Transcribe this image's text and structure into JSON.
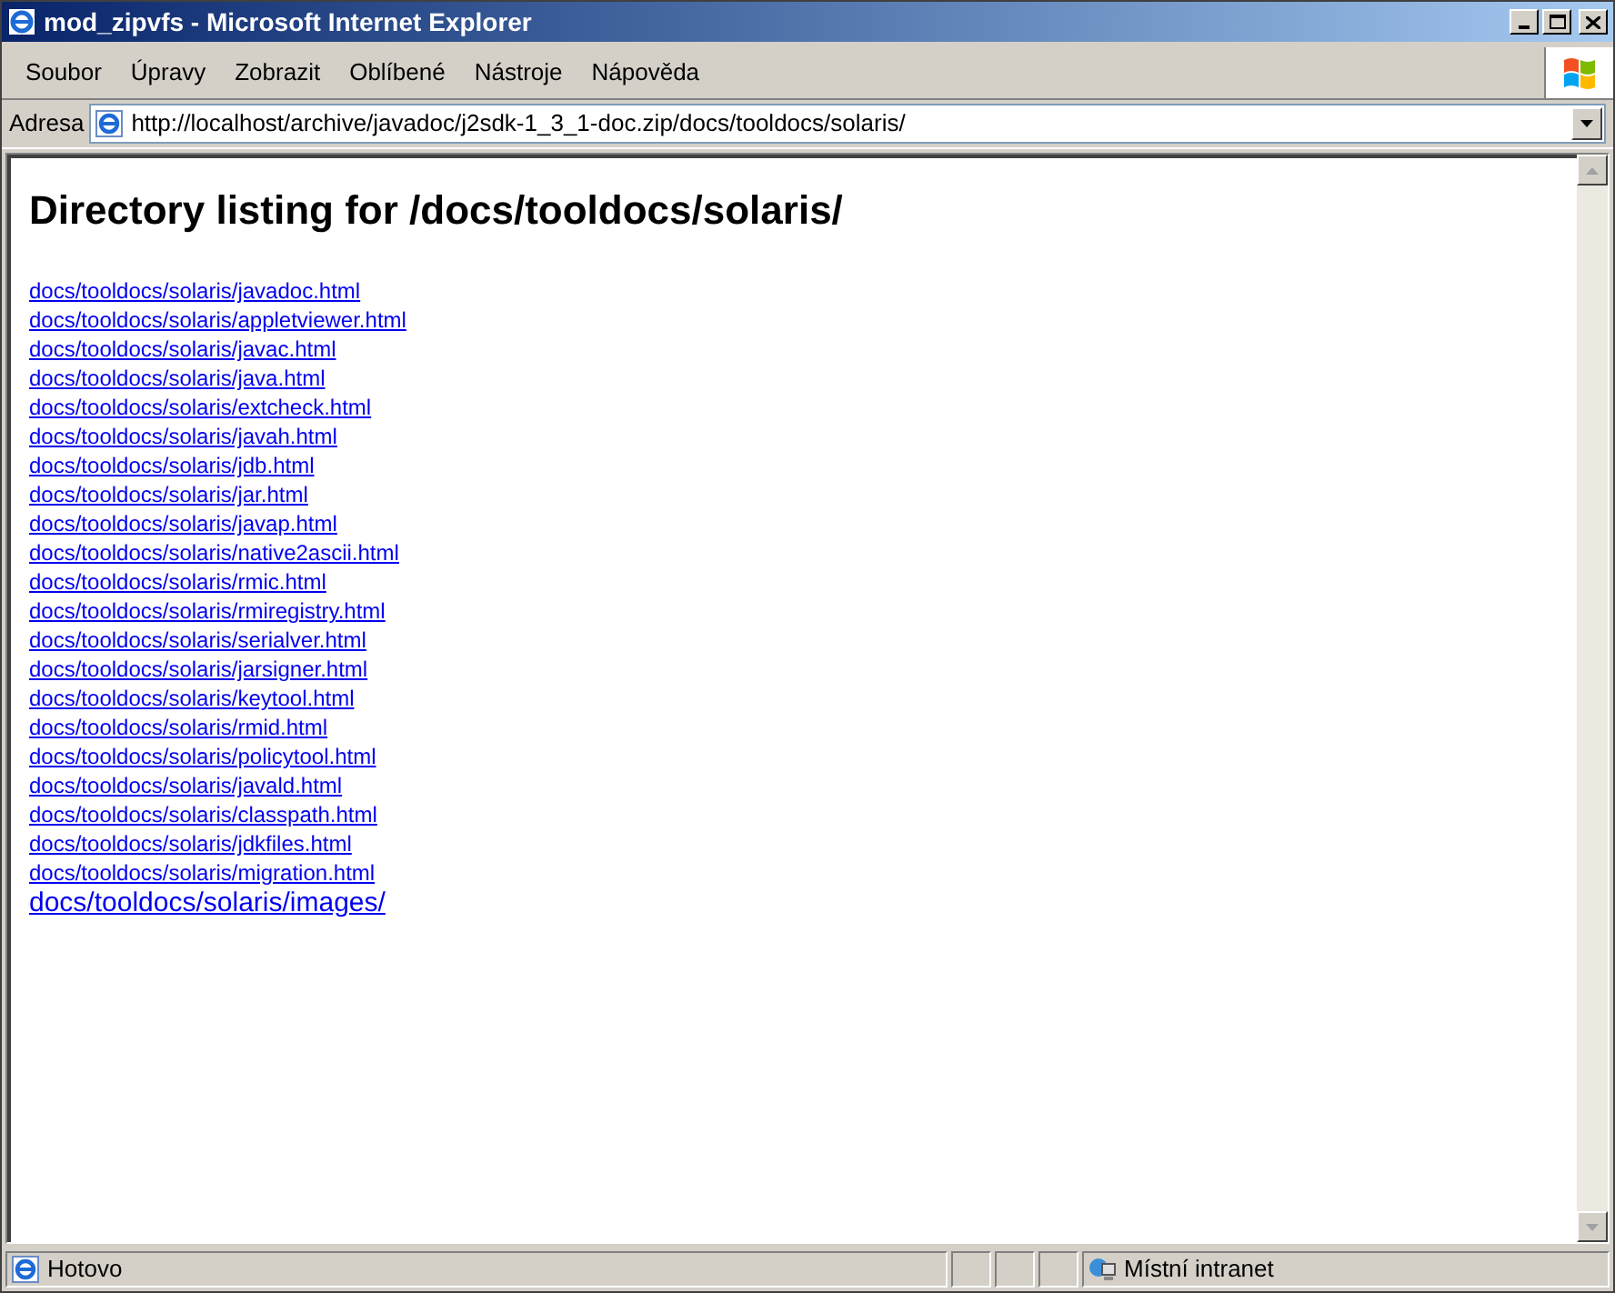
{
  "window": {
    "title": "mod_zipvfs - Microsoft Internet Explorer"
  },
  "menu": [
    "Soubor",
    "Úpravy",
    "Zobrazit",
    "Oblíbené",
    "Nástroje",
    "Nápověda"
  ],
  "address_bar": {
    "label": "Adresa",
    "value": "http://localhost/archive/javadoc/j2sdk-1_3_1-doc.zip/docs/tooldocs/solaris/"
  },
  "page": {
    "heading": "Directory listing for /docs/tooldocs/solaris/",
    "links": [
      {
        "text": "docs/tooldocs/solaris/javadoc.html",
        "kind": "file"
      },
      {
        "text": "docs/tooldocs/solaris/appletviewer.html",
        "kind": "file"
      },
      {
        "text": "docs/tooldocs/solaris/javac.html",
        "kind": "file"
      },
      {
        "text": "docs/tooldocs/solaris/java.html",
        "kind": "file"
      },
      {
        "text": "docs/tooldocs/solaris/extcheck.html",
        "kind": "file"
      },
      {
        "text": "docs/tooldocs/solaris/javah.html",
        "kind": "file"
      },
      {
        "text": "docs/tooldocs/solaris/jdb.html",
        "kind": "file"
      },
      {
        "text": "docs/tooldocs/solaris/jar.html",
        "kind": "file"
      },
      {
        "text": "docs/tooldocs/solaris/javap.html",
        "kind": "file"
      },
      {
        "text": "docs/tooldocs/solaris/native2ascii.html",
        "kind": "file"
      },
      {
        "text": "docs/tooldocs/solaris/rmic.html",
        "kind": "file"
      },
      {
        "text": "docs/tooldocs/solaris/rmiregistry.html",
        "kind": "file"
      },
      {
        "text": "docs/tooldocs/solaris/serialver.html",
        "kind": "file"
      },
      {
        "text": "docs/tooldocs/solaris/jarsigner.html",
        "kind": "file"
      },
      {
        "text": "docs/tooldocs/solaris/keytool.html",
        "kind": "file"
      },
      {
        "text": "docs/tooldocs/solaris/rmid.html",
        "kind": "file"
      },
      {
        "text": "docs/tooldocs/solaris/policytool.html",
        "kind": "file"
      },
      {
        "text": "docs/tooldocs/solaris/javald.html",
        "kind": "file"
      },
      {
        "text": "docs/tooldocs/solaris/classpath.html",
        "kind": "file"
      },
      {
        "text": "docs/tooldocs/solaris/jdkfiles.html",
        "kind": "file"
      },
      {
        "text": "docs/tooldocs/solaris/migration.html",
        "kind": "file"
      },
      {
        "text": "docs/tooldocs/solaris/images/",
        "kind": "folder"
      }
    ]
  },
  "status_bar": {
    "text": "Hotovo",
    "zone": "Místní intranet"
  }
}
